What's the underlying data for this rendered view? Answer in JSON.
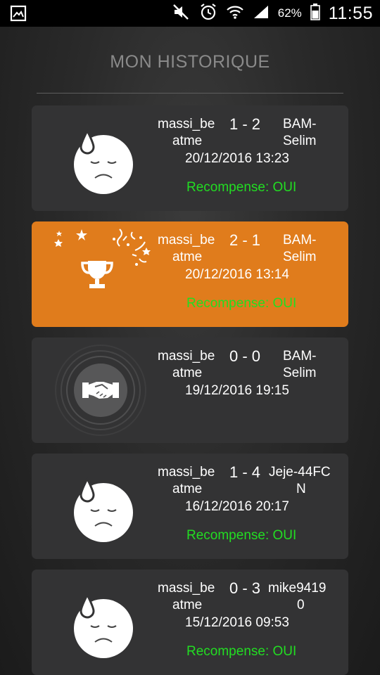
{
  "status_bar": {
    "battery_text": "62%",
    "time": "11:55",
    "icons": [
      "gallery-icon",
      "mute-icon",
      "alarm-icon",
      "wifi-icon",
      "signal-icon",
      "battery-icon"
    ]
  },
  "page": {
    "title": "MON HISTORIQUE"
  },
  "colors": {
    "win_card": "#e07c1c",
    "card": "#333334",
    "reward_text": "#22dd22"
  },
  "matches": [
    {
      "result_icon": "sad-face-icon",
      "player_line1": "massi_be",
      "player_line2": "atme",
      "score": "1 - 2",
      "opponent_line1": "BAM-",
      "opponent_line2": "Selim",
      "datetime": "20/12/2016 13:23",
      "reward": "Recompense: OUI"
    },
    {
      "result_icon": "trophy-icon",
      "player_line1": "massi_be",
      "player_line2": "atme",
      "score": "2 - 1",
      "opponent_line1": "BAM-",
      "opponent_line2": "Selim",
      "datetime": "20/12/2016 13:14",
      "reward": "Recompense: OUI"
    },
    {
      "result_icon": "handshake-icon",
      "player_line1": "massi_be",
      "player_line2": "atme",
      "score": "0 - 0",
      "opponent_line1": "BAM-",
      "opponent_line2": "Selim",
      "datetime": "19/12/2016 19:15"
    },
    {
      "result_icon": "sad-face-icon",
      "player_line1": "massi_be",
      "player_line2": "atme",
      "score": "1 - 4",
      "opponent_line1": "Jeje-44FC",
      "opponent_line2": "N",
      "datetime": "16/12/2016 20:17",
      "reward": "Recompense: OUI"
    },
    {
      "result_icon": "sad-face-icon",
      "player_line1": "massi_be",
      "player_line2": "atme",
      "score": "0 - 3",
      "opponent_line1": "mike9419",
      "opponent_line2": "0",
      "datetime": "15/12/2016 09:53",
      "reward": "Recompense: OUI"
    }
  ]
}
